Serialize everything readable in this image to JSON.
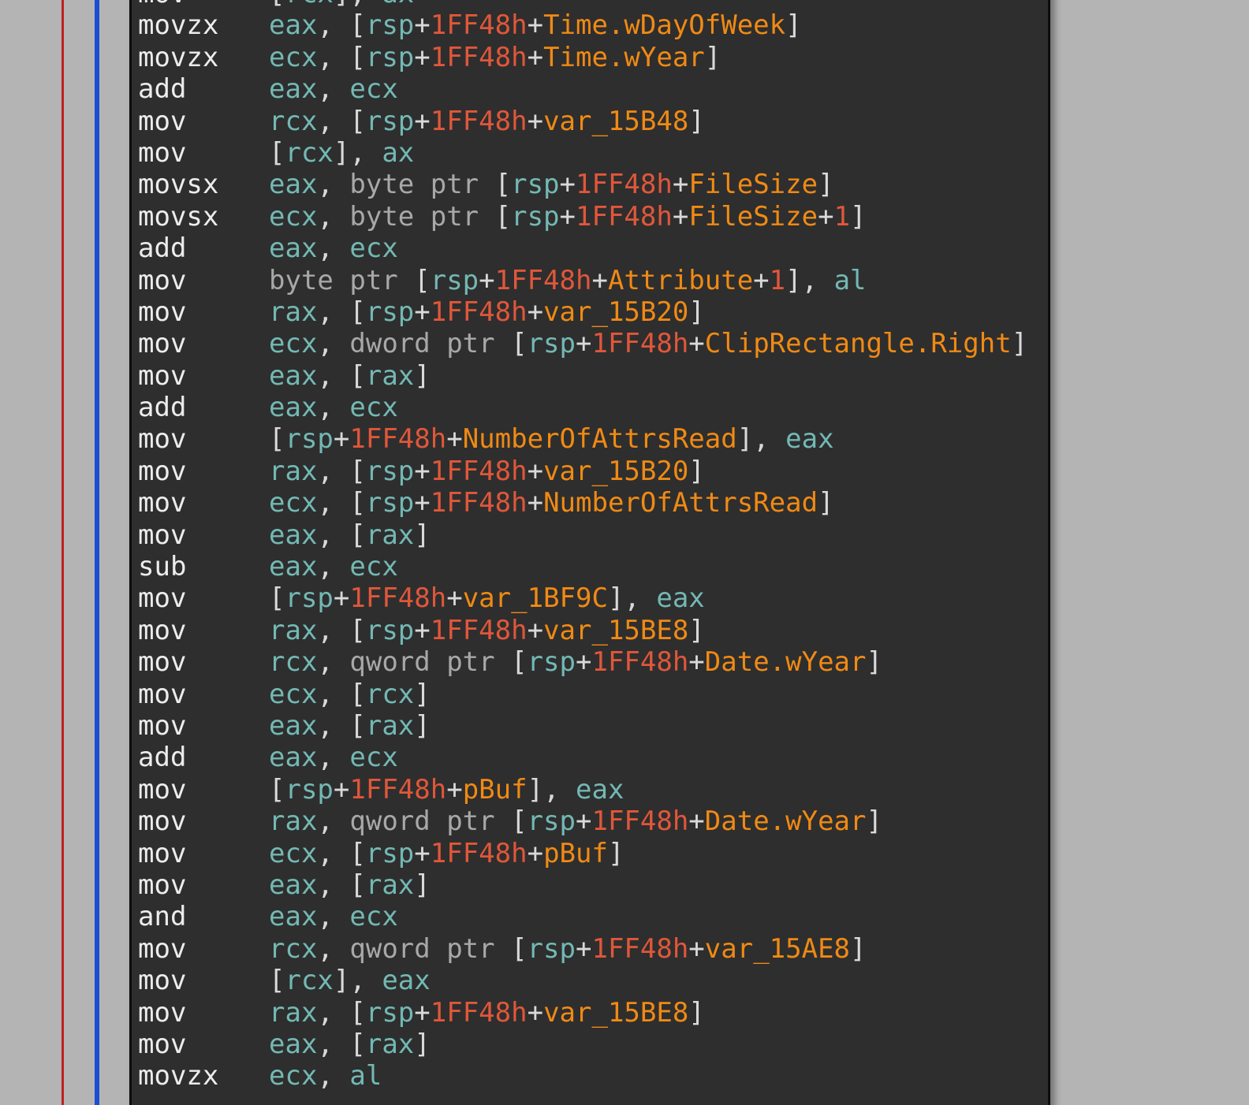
{
  "listing": {
    "lines": [
      {
        "mnemonic": "mov",
        "operands": [
          {
            "t": "punct",
            "v": "["
          },
          {
            "t": "reg",
            "v": "rcx"
          },
          {
            "t": "punct",
            "v": "], "
          },
          {
            "t": "reg",
            "v": "ax"
          }
        ]
      },
      {
        "mnemonic": "movzx",
        "operands": [
          {
            "t": "reg",
            "v": "eax"
          },
          {
            "t": "punct",
            "v": ", ["
          },
          {
            "t": "reg",
            "v": "rsp"
          },
          {
            "t": "punct",
            "v": "+"
          },
          {
            "t": "num",
            "v": "1FF48h"
          },
          {
            "t": "punct",
            "v": "+"
          },
          {
            "t": "sym",
            "v": "Time.wDayOfWeek"
          },
          {
            "t": "punct",
            "v": "]"
          }
        ]
      },
      {
        "mnemonic": "movzx",
        "operands": [
          {
            "t": "reg",
            "v": "ecx"
          },
          {
            "t": "punct",
            "v": ", ["
          },
          {
            "t": "reg",
            "v": "rsp"
          },
          {
            "t": "punct",
            "v": "+"
          },
          {
            "t": "num",
            "v": "1FF48h"
          },
          {
            "t": "punct",
            "v": "+"
          },
          {
            "t": "sym",
            "v": "Time.wYear"
          },
          {
            "t": "punct",
            "v": "]"
          }
        ]
      },
      {
        "mnemonic": "add",
        "operands": [
          {
            "t": "reg",
            "v": "eax"
          },
          {
            "t": "punct",
            "v": ", "
          },
          {
            "t": "reg",
            "v": "ecx"
          }
        ]
      },
      {
        "mnemonic": "mov",
        "operands": [
          {
            "t": "reg",
            "v": "rcx"
          },
          {
            "t": "punct",
            "v": ", ["
          },
          {
            "t": "reg",
            "v": "rsp"
          },
          {
            "t": "punct",
            "v": "+"
          },
          {
            "t": "num",
            "v": "1FF48h"
          },
          {
            "t": "punct",
            "v": "+"
          },
          {
            "t": "sym",
            "v": "var_15B48"
          },
          {
            "t": "punct",
            "v": "]"
          }
        ]
      },
      {
        "mnemonic": "mov",
        "operands": [
          {
            "t": "punct",
            "v": "["
          },
          {
            "t": "reg",
            "v": "rcx"
          },
          {
            "t": "punct",
            "v": "], "
          },
          {
            "t": "reg",
            "v": "ax"
          }
        ]
      },
      {
        "mnemonic": "movsx",
        "operands": [
          {
            "t": "reg",
            "v": "eax"
          },
          {
            "t": "punct",
            "v": ", "
          },
          {
            "t": "kw",
            "v": "byte ptr "
          },
          {
            "t": "punct",
            "v": "["
          },
          {
            "t": "reg",
            "v": "rsp"
          },
          {
            "t": "punct",
            "v": "+"
          },
          {
            "t": "num",
            "v": "1FF48h"
          },
          {
            "t": "punct",
            "v": "+"
          },
          {
            "t": "sym",
            "v": "FileSize"
          },
          {
            "t": "punct",
            "v": "]"
          }
        ]
      },
      {
        "mnemonic": "movsx",
        "operands": [
          {
            "t": "reg",
            "v": "ecx"
          },
          {
            "t": "punct",
            "v": ", "
          },
          {
            "t": "kw",
            "v": "byte ptr "
          },
          {
            "t": "punct",
            "v": "["
          },
          {
            "t": "reg",
            "v": "rsp"
          },
          {
            "t": "punct",
            "v": "+"
          },
          {
            "t": "num",
            "v": "1FF48h"
          },
          {
            "t": "punct",
            "v": "+"
          },
          {
            "t": "sym",
            "v": "FileSize"
          },
          {
            "t": "punct",
            "v": "+"
          },
          {
            "t": "num",
            "v": "1"
          },
          {
            "t": "punct",
            "v": "]"
          }
        ]
      },
      {
        "mnemonic": "add",
        "operands": [
          {
            "t": "reg",
            "v": "eax"
          },
          {
            "t": "punct",
            "v": ", "
          },
          {
            "t": "reg",
            "v": "ecx"
          }
        ]
      },
      {
        "mnemonic": "mov",
        "operands": [
          {
            "t": "kw",
            "v": "byte ptr "
          },
          {
            "t": "punct",
            "v": "["
          },
          {
            "t": "reg",
            "v": "rsp"
          },
          {
            "t": "punct",
            "v": "+"
          },
          {
            "t": "num",
            "v": "1FF48h"
          },
          {
            "t": "punct",
            "v": "+"
          },
          {
            "t": "sym",
            "v": "Attribute"
          },
          {
            "t": "punct",
            "v": "+"
          },
          {
            "t": "num",
            "v": "1"
          },
          {
            "t": "punct",
            "v": "], "
          },
          {
            "t": "reg",
            "v": "al"
          }
        ]
      },
      {
        "mnemonic": "mov",
        "operands": [
          {
            "t": "reg",
            "v": "rax"
          },
          {
            "t": "punct",
            "v": ", ["
          },
          {
            "t": "reg",
            "v": "rsp"
          },
          {
            "t": "punct",
            "v": "+"
          },
          {
            "t": "num",
            "v": "1FF48h"
          },
          {
            "t": "punct",
            "v": "+"
          },
          {
            "t": "sym",
            "v": "var_15B20"
          },
          {
            "t": "punct",
            "v": "]"
          }
        ]
      },
      {
        "mnemonic": "mov",
        "operands": [
          {
            "t": "reg",
            "v": "ecx"
          },
          {
            "t": "punct",
            "v": ", "
          },
          {
            "t": "kw",
            "v": "dword ptr "
          },
          {
            "t": "punct",
            "v": "["
          },
          {
            "t": "reg",
            "v": "rsp"
          },
          {
            "t": "punct",
            "v": "+"
          },
          {
            "t": "num",
            "v": "1FF48h"
          },
          {
            "t": "punct",
            "v": "+"
          },
          {
            "t": "sym",
            "v": "ClipRectangle.Right"
          },
          {
            "t": "punct",
            "v": "]"
          }
        ]
      },
      {
        "mnemonic": "mov",
        "operands": [
          {
            "t": "reg",
            "v": "eax"
          },
          {
            "t": "punct",
            "v": ", ["
          },
          {
            "t": "reg",
            "v": "rax"
          },
          {
            "t": "punct",
            "v": "]"
          }
        ]
      },
      {
        "mnemonic": "add",
        "operands": [
          {
            "t": "reg",
            "v": "eax"
          },
          {
            "t": "punct",
            "v": ", "
          },
          {
            "t": "reg",
            "v": "ecx"
          }
        ]
      },
      {
        "mnemonic": "mov",
        "operands": [
          {
            "t": "punct",
            "v": "["
          },
          {
            "t": "reg",
            "v": "rsp"
          },
          {
            "t": "punct",
            "v": "+"
          },
          {
            "t": "num",
            "v": "1FF48h"
          },
          {
            "t": "punct",
            "v": "+"
          },
          {
            "t": "sym",
            "v": "NumberOfAttrsRead"
          },
          {
            "t": "punct",
            "v": "], "
          },
          {
            "t": "reg",
            "v": "eax"
          }
        ]
      },
      {
        "mnemonic": "mov",
        "operands": [
          {
            "t": "reg",
            "v": "rax"
          },
          {
            "t": "punct",
            "v": ", ["
          },
          {
            "t": "reg",
            "v": "rsp"
          },
          {
            "t": "punct",
            "v": "+"
          },
          {
            "t": "num",
            "v": "1FF48h"
          },
          {
            "t": "punct",
            "v": "+"
          },
          {
            "t": "sym",
            "v": "var_15B20"
          },
          {
            "t": "punct",
            "v": "]"
          }
        ]
      },
      {
        "mnemonic": "mov",
        "operands": [
          {
            "t": "reg",
            "v": "ecx"
          },
          {
            "t": "punct",
            "v": ", ["
          },
          {
            "t": "reg",
            "v": "rsp"
          },
          {
            "t": "punct",
            "v": "+"
          },
          {
            "t": "num",
            "v": "1FF48h"
          },
          {
            "t": "punct",
            "v": "+"
          },
          {
            "t": "sym",
            "v": "NumberOfAttrsRead"
          },
          {
            "t": "punct",
            "v": "]"
          }
        ]
      },
      {
        "mnemonic": "mov",
        "operands": [
          {
            "t": "reg",
            "v": "eax"
          },
          {
            "t": "punct",
            "v": ", ["
          },
          {
            "t": "reg",
            "v": "rax"
          },
          {
            "t": "punct",
            "v": "]"
          }
        ]
      },
      {
        "mnemonic": "sub",
        "operands": [
          {
            "t": "reg",
            "v": "eax"
          },
          {
            "t": "punct",
            "v": ", "
          },
          {
            "t": "reg",
            "v": "ecx"
          }
        ]
      },
      {
        "mnemonic": "mov",
        "operands": [
          {
            "t": "punct",
            "v": "["
          },
          {
            "t": "reg",
            "v": "rsp"
          },
          {
            "t": "punct",
            "v": "+"
          },
          {
            "t": "num",
            "v": "1FF48h"
          },
          {
            "t": "punct",
            "v": "+"
          },
          {
            "t": "sym",
            "v": "var_1BF9C"
          },
          {
            "t": "punct",
            "v": "], "
          },
          {
            "t": "reg",
            "v": "eax"
          }
        ]
      },
      {
        "mnemonic": "mov",
        "operands": [
          {
            "t": "reg",
            "v": "rax"
          },
          {
            "t": "punct",
            "v": ", ["
          },
          {
            "t": "reg",
            "v": "rsp"
          },
          {
            "t": "punct",
            "v": "+"
          },
          {
            "t": "num",
            "v": "1FF48h"
          },
          {
            "t": "punct",
            "v": "+"
          },
          {
            "t": "sym",
            "v": "var_15BE8"
          },
          {
            "t": "punct",
            "v": "]"
          }
        ]
      },
      {
        "mnemonic": "mov",
        "operands": [
          {
            "t": "reg",
            "v": "rcx"
          },
          {
            "t": "punct",
            "v": ", "
          },
          {
            "t": "kw",
            "v": "qword ptr "
          },
          {
            "t": "punct",
            "v": "["
          },
          {
            "t": "reg",
            "v": "rsp"
          },
          {
            "t": "punct",
            "v": "+"
          },
          {
            "t": "num",
            "v": "1FF48h"
          },
          {
            "t": "punct",
            "v": "+"
          },
          {
            "t": "sym",
            "v": "Date.wYear"
          },
          {
            "t": "punct",
            "v": "]"
          }
        ]
      },
      {
        "mnemonic": "mov",
        "operands": [
          {
            "t": "reg",
            "v": "ecx"
          },
          {
            "t": "punct",
            "v": ", ["
          },
          {
            "t": "reg",
            "v": "rcx"
          },
          {
            "t": "punct",
            "v": "]"
          }
        ]
      },
      {
        "mnemonic": "mov",
        "operands": [
          {
            "t": "reg",
            "v": "eax"
          },
          {
            "t": "punct",
            "v": ", ["
          },
          {
            "t": "reg",
            "v": "rax"
          },
          {
            "t": "punct",
            "v": "]"
          }
        ]
      },
      {
        "mnemonic": "add",
        "operands": [
          {
            "t": "reg",
            "v": "eax"
          },
          {
            "t": "punct",
            "v": ", "
          },
          {
            "t": "reg",
            "v": "ecx"
          }
        ]
      },
      {
        "mnemonic": "mov",
        "operands": [
          {
            "t": "punct",
            "v": "["
          },
          {
            "t": "reg",
            "v": "rsp"
          },
          {
            "t": "punct",
            "v": "+"
          },
          {
            "t": "num",
            "v": "1FF48h"
          },
          {
            "t": "punct",
            "v": "+"
          },
          {
            "t": "sym",
            "v": "pBuf"
          },
          {
            "t": "punct",
            "v": "], "
          },
          {
            "t": "reg",
            "v": "eax"
          }
        ]
      },
      {
        "mnemonic": "mov",
        "operands": [
          {
            "t": "reg",
            "v": "rax"
          },
          {
            "t": "punct",
            "v": ", "
          },
          {
            "t": "kw",
            "v": "qword ptr "
          },
          {
            "t": "punct",
            "v": "["
          },
          {
            "t": "reg",
            "v": "rsp"
          },
          {
            "t": "punct",
            "v": "+"
          },
          {
            "t": "num",
            "v": "1FF48h"
          },
          {
            "t": "punct",
            "v": "+"
          },
          {
            "t": "sym",
            "v": "Date.wYear"
          },
          {
            "t": "punct",
            "v": "]"
          }
        ]
      },
      {
        "mnemonic": "mov",
        "operands": [
          {
            "t": "reg",
            "v": "ecx"
          },
          {
            "t": "punct",
            "v": ", ["
          },
          {
            "t": "reg",
            "v": "rsp"
          },
          {
            "t": "punct",
            "v": "+"
          },
          {
            "t": "num",
            "v": "1FF48h"
          },
          {
            "t": "punct",
            "v": "+"
          },
          {
            "t": "sym",
            "v": "pBuf"
          },
          {
            "t": "punct",
            "v": "]"
          }
        ]
      },
      {
        "mnemonic": "mov",
        "operands": [
          {
            "t": "reg",
            "v": "eax"
          },
          {
            "t": "punct",
            "v": ", ["
          },
          {
            "t": "reg",
            "v": "rax"
          },
          {
            "t": "punct",
            "v": "]"
          }
        ]
      },
      {
        "mnemonic": "and",
        "operands": [
          {
            "t": "reg",
            "v": "eax"
          },
          {
            "t": "punct",
            "v": ", "
          },
          {
            "t": "reg",
            "v": "ecx"
          }
        ]
      },
      {
        "mnemonic": "mov",
        "operands": [
          {
            "t": "reg",
            "v": "rcx"
          },
          {
            "t": "punct",
            "v": ", "
          },
          {
            "t": "kw",
            "v": "qword ptr "
          },
          {
            "t": "punct",
            "v": "["
          },
          {
            "t": "reg",
            "v": "rsp"
          },
          {
            "t": "punct",
            "v": "+"
          },
          {
            "t": "num",
            "v": "1FF48h"
          },
          {
            "t": "punct",
            "v": "+"
          },
          {
            "t": "sym",
            "v": "var_15AE8"
          },
          {
            "t": "punct",
            "v": "]"
          }
        ]
      },
      {
        "mnemonic": "mov",
        "operands": [
          {
            "t": "punct",
            "v": "["
          },
          {
            "t": "reg",
            "v": "rcx"
          },
          {
            "t": "punct",
            "v": "], "
          },
          {
            "t": "reg",
            "v": "eax"
          }
        ]
      },
      {
        "mnemonic": "mov",
        "operands": [
          {
            "t": "reg",
            "v": "rax"
          },
          {
            "t": "punct",
            "v": ", ["
          },
          {
            "t": "reg",
            "v": "rsp"
          },
          {
            "t": "punct",
            "v": "+"
          },
          {
            "t": "num",
            "v": "1FF48h"
          },
          {
            "t": "punct",
            "v": "+"
          },
          {
            "t": "sym",
            "v": "var_15BE8"
          },
          {
            "t": "punct",
            "v": "]"
          }
        ]
      },
      {
        "mnemonic": "mov",
        "operands": [
          {
            "t": "reg",
            "v": "eax"
          },
          {
            "t": "punct",
            "v": ", ["
          },
          {
            "t": "reg",
            "v": "rax"
          },
          {
            "t": "punct",
            "v": "]"
          }
        ]
      },
      {
        "mnemonic": "movzx",
        "operands": [
          {
            "t": "reg",
            "v": "ecx"
          },
          {
            "t": "punct",
            "v": ", "
          },
          {
            "t": "reg",
            "v": "al"
          }
        ]
      }
    ]
  },
  "colors": {
    "background": "#b4b4b4",
    "panel": "#2e2e2e",
    "mnemonic": "#ececec",
    "register": "#73b8b4",
    "punctuation": "#d9d9d9",
    "size_keyword": "#a8a8a8",
    "number": "#e0573a",
    "symbol": "#f08a14",
    "edge_red": "#c02020",
    "edge_blue": "#1a4fd0"
  }
}
